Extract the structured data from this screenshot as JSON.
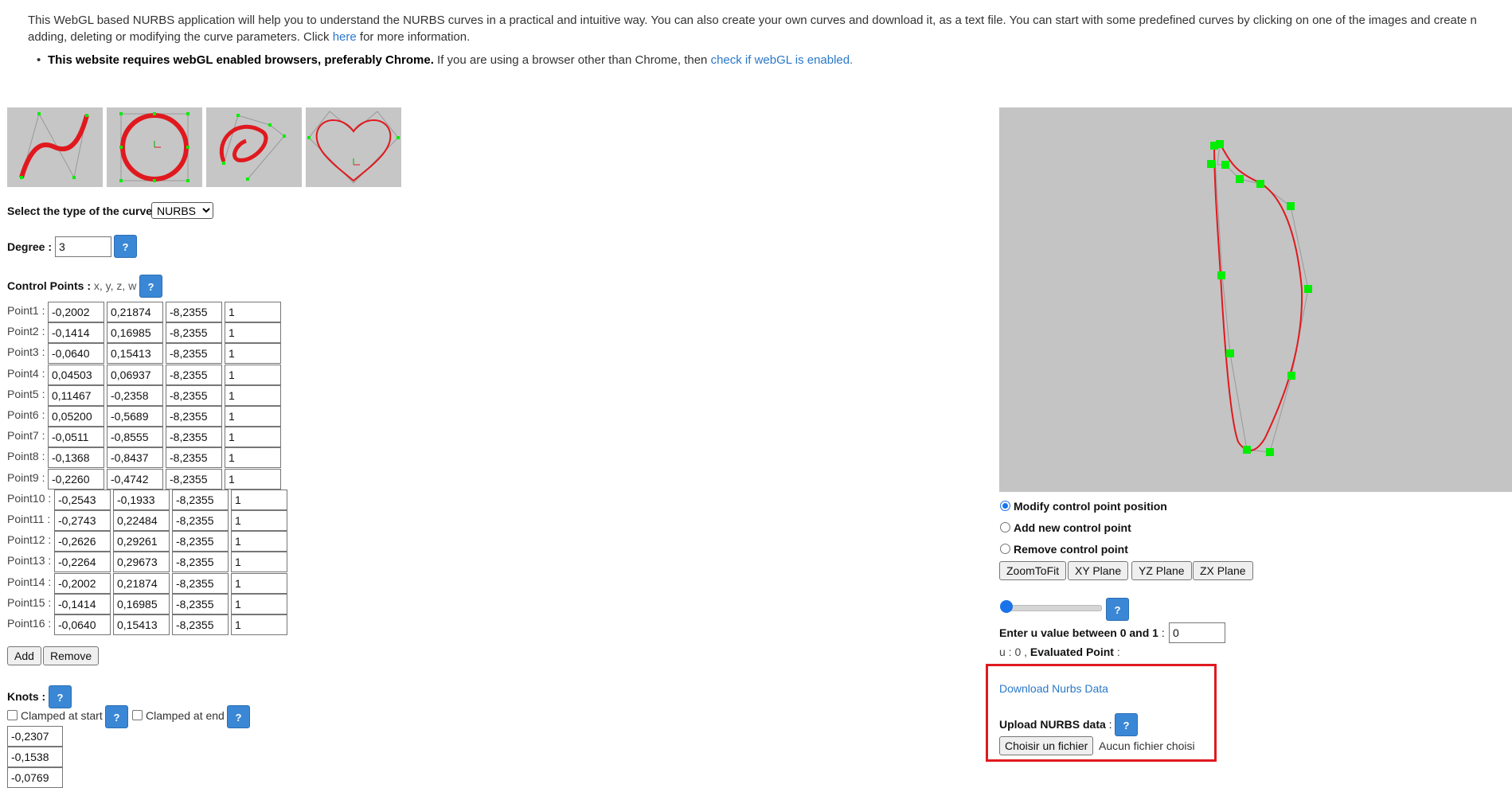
{
  "intro": {
    "line1": "This WebGL based NURBS application will help you to understand the NURBS curves in a practical and intuitive way. You can also create your own curves and download it, as a text file. You can start with some predefined curves by clicking on one of the images and create new curves, by",
    "line2_before": "adding, deleting or modifying the curve parameters. Click ",
    "here_link": "here",
    "line2_after": " for more information."
  },
  "note": {
    "bold_text": "This website requires webGL enabled browsers, preferably Chrome.",
    "text": " If you are using a browser other than Chrome, then ",
    "link": "check if webGL is enabled."
  },
  "presets": [
    {
      "name": "s-curve"
    },
    {
      "name": "circle"
    },
    {
      "name": "spiral"
    },
    {
      "name": "heart"
    }
  ],
  "curve_type": {
    "label": "Select the type of the curve",
    "selected": "NURBS"
  },
  "degree": {
    "label": "Degree :",
    "value": "3"
  },
  "help_label": "?",
  "control_points": {
    "label": "Control Points :",
    "sub_label": " x, y, z, w",
    "rows": [
      {
        "label": "Point1 :",
        "x": "-0,2002",
        "y": "0,21874",
        "z": "-8,2355",
        "w": "1"
      },
      {
        "label": "Point2 :",
        "x": "-0,1414",
        "y": "0,16985",
        "z": "-8,2355",
        "w": "1"
      },
      {
        "label": "Point3 :",
        "x": "-0,0640",
        "y": "0,15413",
        "z": "-8,2355",
        "w": "1"
      },
      {
        "label": "Point4 :",
        "x": "0,04503",
        "y": "0,06937",
        "z": "-8,2355",
        "w": "1"
      },
      {
        "label": "Point5 :",
        "x": "0,11467",
        "y": "-0,2358",
        "z": "-8,2355",
        "w": "1"
      },
      {
        "label": "Point6 :",
        "x": "0,05200",
        "y": "-0,5689",
        "z": "-8,2355",
        "w": "1"
      },
      {
        "label": "Point7 :",
        "x": "-0,0511",
        "y": "-0,8555",
        "z": "-8,2355",
        "w": "1"
      },
      {
        "label": "Point8 :",
        "x": "-0,1368",
        "y": "-0,8437",
        "z": "-8,2355",
        "w": "1"
      },
      {
        "label": "Point9 :",
        "x": "-0,2260",
        "y": "-0,4742",
        "z": "-8,2355",
        "w": "1"
      },
      {
        "label": "Point10 :",
        "x": "-0,2543",
        "y": "-0,1933",
        "z": "-8,2355",
        "w": "1"
      },
      {
        "label": "Point11 :",
        "x": "-0,2743",
        "y": "0,22484",
        "z": "-8,2355",
        "w": "1"
      },
      {
        "label": "Point12 :",
        "x": "-0,2626",
        "y": "0,29261",
        "z": "-8,2355",
        "w": "1"
      },
      {
        "label": "Point13 :",
        "x": "-0,2264",
        "y": "0,29673",
        "z": "-8,2355",
        "w": "1"
      },
      {
        "label": "Point14 :",
        "x": "-0,2002",
        "y": "0,21874",
        "z": "-8,2355",
        "w": "1"
      },
      {
        "label": "Point15 :",
        "x": "-0,1414",
        "y": "0,16985",
        "z": "-8,2355",
        "w": "1"
      },
      {
        "label": "Point16 :",
        "x": "-0,0640",
        "y": "0,15413",
        "z": "-8,2355",
        "w": "1"
      }
    ],
    "add_label": "Add",
    "remove_label": "Remove"
  },
  "knots": {
    "label": "Knots :",
    "clamped_start": "Clamped at start",
    "clamped_end": "Clamped at end",
    "values": [
      "-0,2307",
      "-0,1538",
      "-0,0769"
    ]
  },
  "edit_mode": {
    "options": [
      "Modify control point position",
      "Add new control point",
      "Remove control point"
    ],
    "selected": "Modify control point position"
  },
  "view_buttons": [
    "ZoomToFit",
    "XY Plane",
    "YZ Plane",
    "ZX Plane"
  ],
  "u_slider": {
    "value": 0
  },
  "u_input": {
    "label": "Enter u value between 0 and 1",
    "colon": " :",
    "value": "0"
  },
  "evaluated": {
    "u_text": "u : 0 ,",
    "point_label": " Evaluated Point",
    "colon": " :"
  },
  "download": {
    "link": "Download Nurbs Data"
  },
  "upload": {
    "label": "Upload NURBS data",
    "colon": " :",
    "button": "Choisir un fichier",
    "status": "Aucun fichier choisi"
  },
  "colors": {
    "curve": "#e0191e",
    "control_point": "#00ee00",
    "viewer_bg": "#c4c4c4",
    "help_button": "#3a87d6",
    "link": "#2a78c8",
    "highlight": "#e0191e"
  }
}
